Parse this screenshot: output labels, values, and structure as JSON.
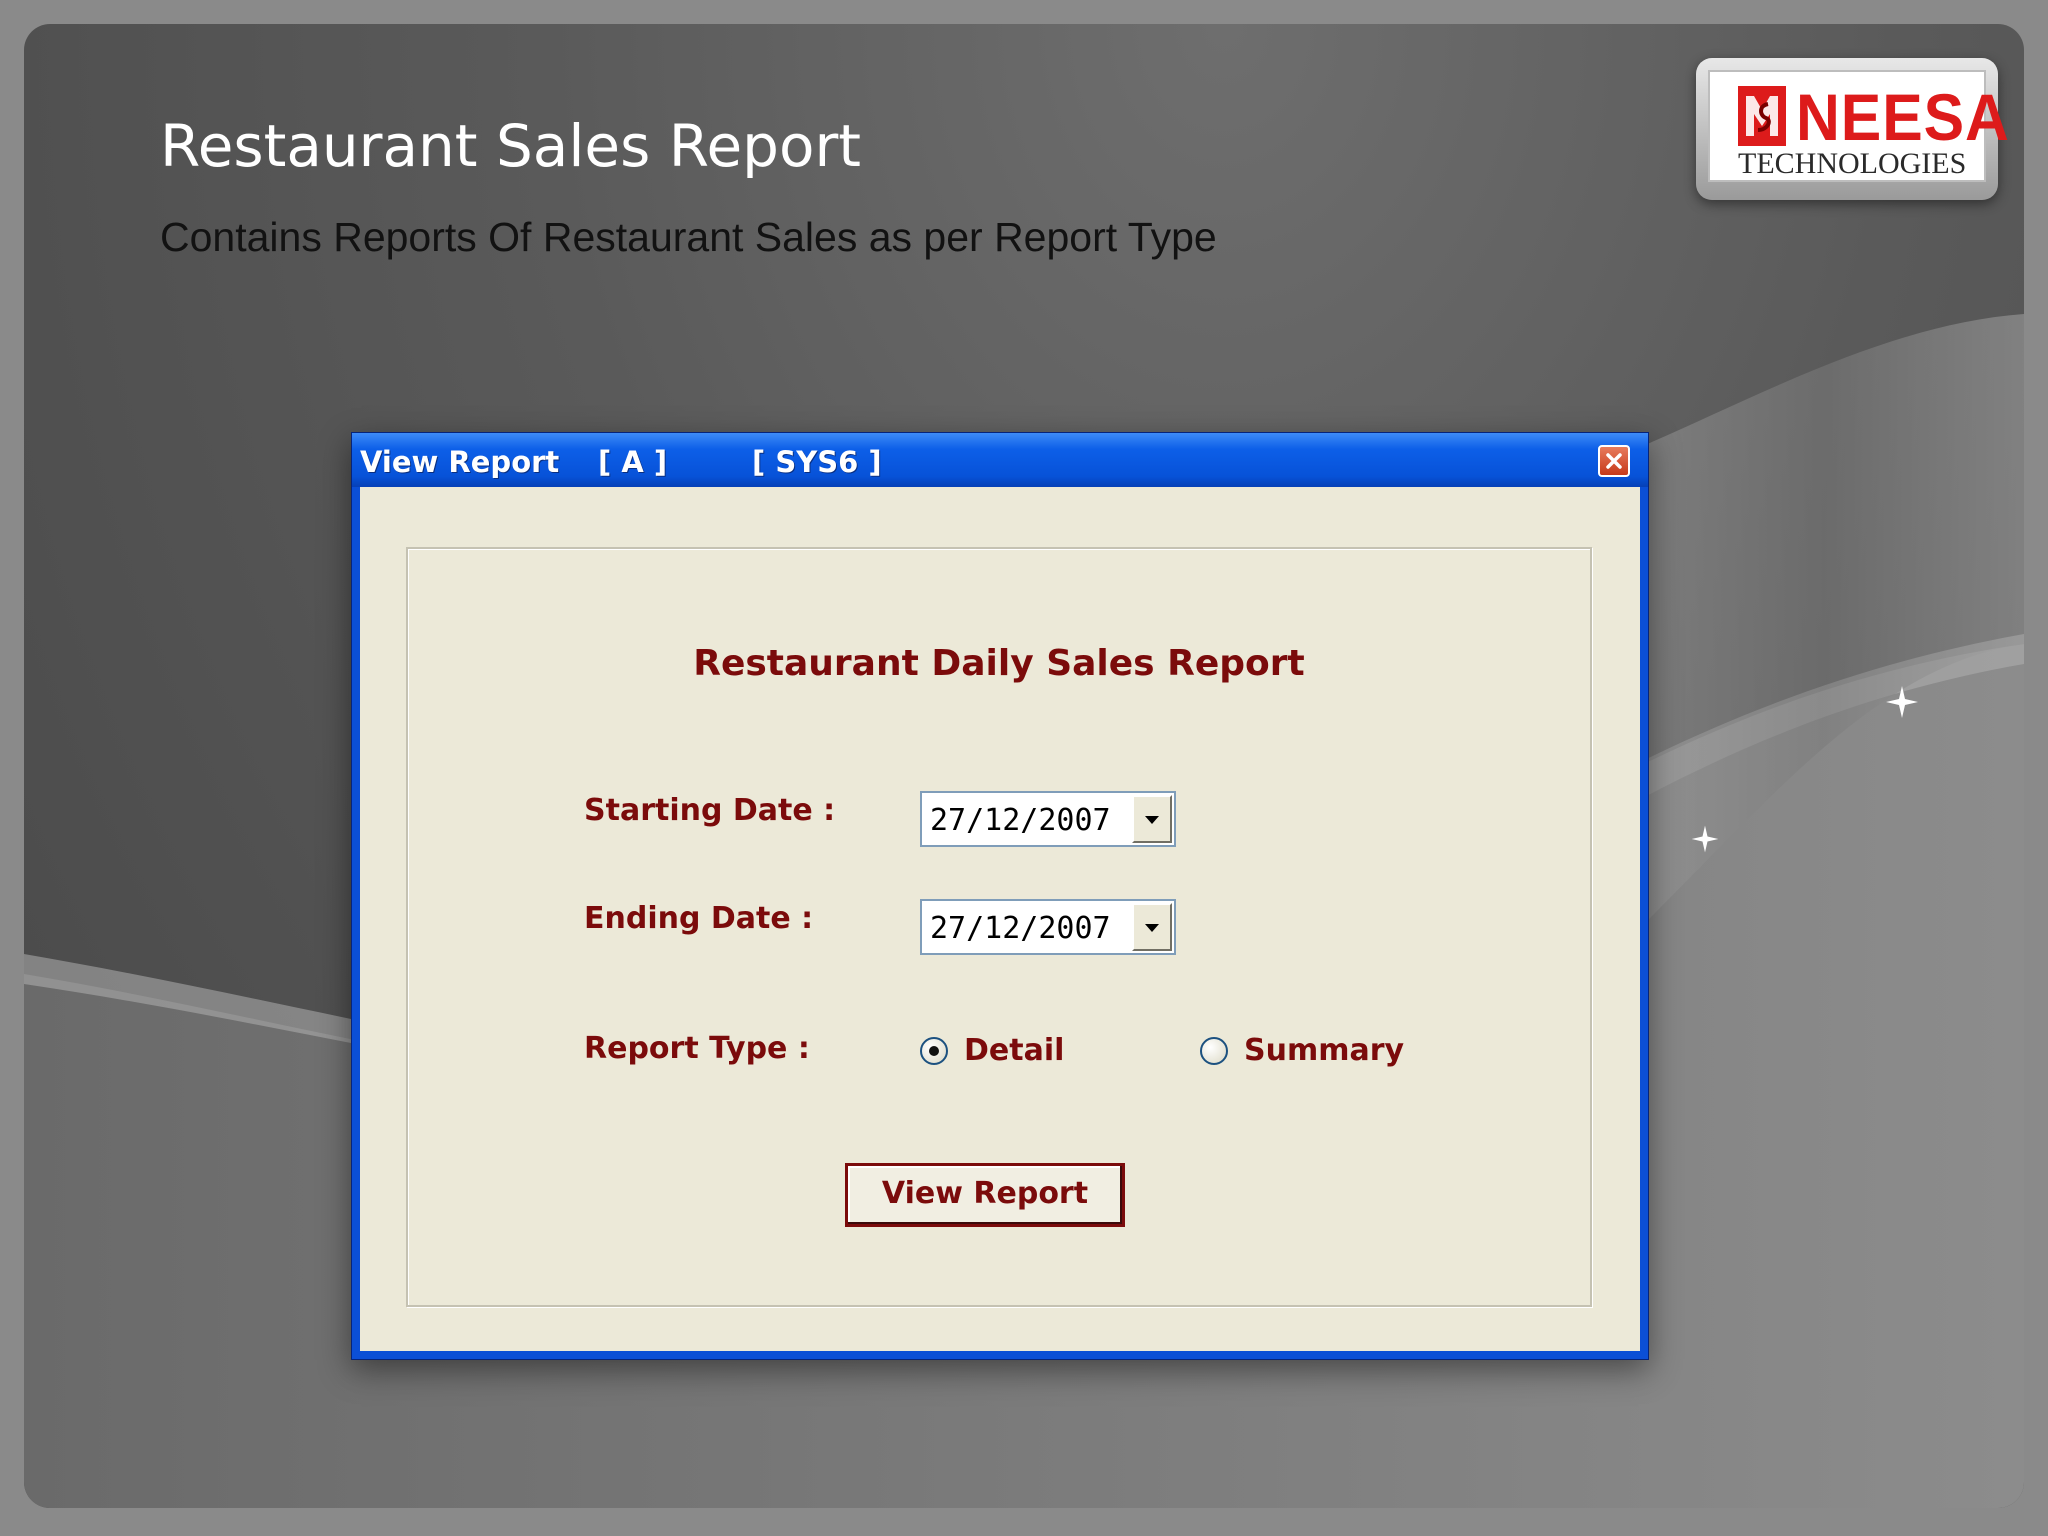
{
  "slide": {
    "title": "Restaurant Sales Report",
    "subtitle": "Contains Reports Of  Restaurant Sales as per Report Type"
  },
  "logo": {
    "name": "NEESA",
    "sub": "TECHNOLOGIES",
    "brand_color": "#dd1b1b"
  },
  "window": {
    "title": "View Report",
    "tag_a": "[ A ]",
    "tag_sys": "[ SYS6 ]",
    "close_icon": "close-icon"
  },
  "form": {
    "heading": "Restaurant Daily Sales Report",
    "starting_date_label": "Starting Date :",
    "starting_date_value": "27/12/2007",
    "ending_date_label": "Ending Date :",
    "ending_date_value": "27/12/2007",
    "report_type_label": "Report Type :",
    "options": [
      {
        "label": "Detail",
        "selected": true
      },
      {
        "label": "Summary",
        "selected": false
      }
    ],
    "view_button": "View Report",
    "label_color": "#7b0b0b"
  }
}
